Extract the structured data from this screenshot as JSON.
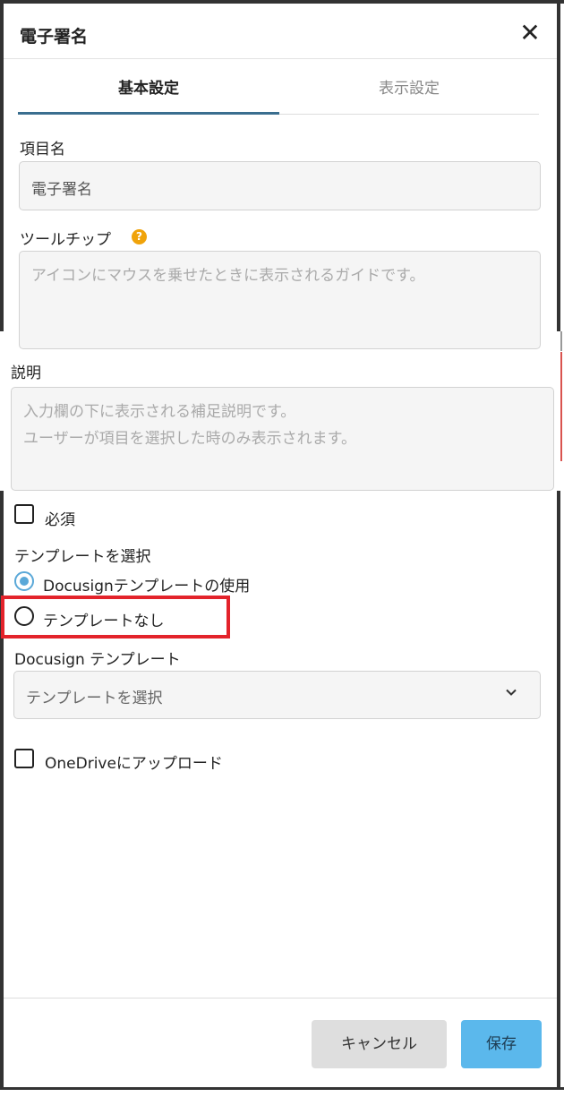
{
  "dialog": {
    "title": "電子署名",
    "close_icon": "close-icon"
  },
  "tabs": [
    {
      "label": "基本設定",
      "active": true
    },
    {
      "label": "表示設定",
      "active": false
    }
  ],
  "form": {
    "item_name": {
      "label": "項目名",
      "value": "電子署名"
    },
    "tooltip": {
      "label": "ツールチップ",
      "help_icon": "?",
      "placeholder": "アイコンにマウスを乗せたときに表示されるガイドです。"
    },
    "description": {
      "label": "説明",
      "placeholder": "入力欄の下に表示される補足説明です。\nユーザーが項目を選択した時のみ表示されます。"
    },
    "required": {
      "label": "必須",
      "checked": false
    },
    "template_choice": {
      "label": "テンプレートを選択",
      "options": [
        {
          "label": "Docusignテンプレートの使用",
          "selected": true
        },
        {
          "label": "テンプレートなし",
          "selected": false
        }
      ]
    },
    "docusign_template": {
      "label": "Docusign テンプレート",
      "selected": "テンプレートを選択"
    },
    "onedrive": {
      "label": "OneDriveにアップロード",
      "checked": false
    }
  },
  "footer": {
    "cancel_label": "キャンセル",
    "save_label": "保存"
  },
  "colors": {
    "accent": "#5bb8ec",
    "tab_indicator": "#3a6e8f",
    "highlight": "#e3232b",
    "help": "#f0a30a"
  }
}
